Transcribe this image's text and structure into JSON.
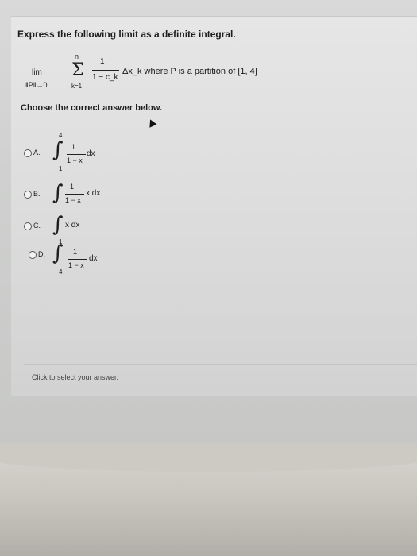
{
  "question": {
    "prompt": "Express the following limit as a definite integral.",
    "limit": {
      "lim": "lim",
      "norm": "‖P‖→0",
      "sum_symbol": "Σ",
      "upper": "n",
      "lower": "k=1",
      "numerator": "1",
      "denominator": "1 − c_k",
      "tail": "Δx_k where P is a partition of [1, 4]"
    }
  },
  "choose_text": "Choose the correct answer below.",
  "options": [
    {
      "label": "A.",
      "upper": "4",
      "lower": "1",
      "numerator": "1",
      "denominator": "1 − x",
      "tail": "dx"
    },
    {
      "label": "B.",
      "upper": "",
      "lower": "",
      "numerator": "1",
      "denominator": "1 − x",
      "tail": "x dx"
    },
    {
      "label": "C.",
      "upper": "",
      "lower": "",
      "expression": "x dx"
    },
    {
      "label": "D.",
      "upper": "1",
      "lower": "4",
      "numerator": "1",
      "denominator": "1 − x",
      "tail": "dx"
    }
  ],
  "answer_prompt": "Click to select your answer."
}
